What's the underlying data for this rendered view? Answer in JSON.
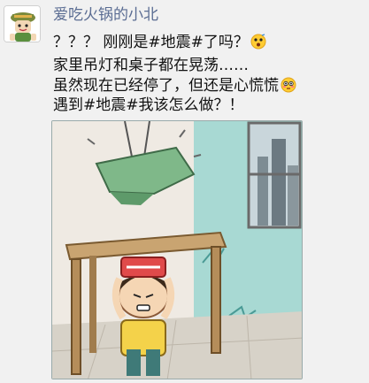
{
  "post": {
    "username": "爱吃火锅的小北",
    "lines": [
      "？？？ 刚刚是#地震#了吗？",
      "家里吊灯和桌子都在晃荡……",
      "虽然现在已经停了，但还是心慌慌",
      "遇到#地震#我该怎么做？！"
    ],
    "emojis": [
      "surprised-emoji",
      "flushed-emoji"
    ],
    "image_icon": "earthquake-cartoon-illustration"
  },
  "colors": {
    "username": "#5b6d93",
    "text": "#111111",
    "background": "#f1f1f1"
  }
}
